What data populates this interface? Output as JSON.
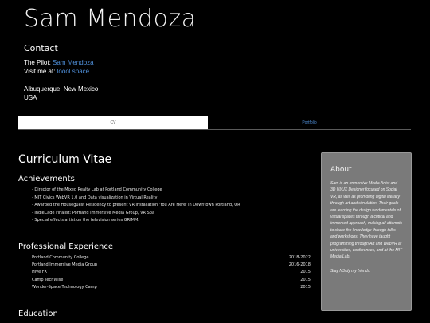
{
  "header": {
    "name": "Sam Mendoza"
  },
  "contact": {
    "heading": "Contact",
    "pilot_prefix": "The Pilot: ",
    "pilot_link": "Sam Mendoza",
    "visit_prefix": "Visit me at: ",
    "visit_link": "loool.space",
    "city": "Albuquerque, New Mexico",
    "country": "USA"
  },
  "tabs": [
    {
      "label": "CV",
      "active": true
    },
    {
      "label": "Portfolio",
      "active": false
    }
  ],
  "main": {
    "title": "Curriculum Vitae",
    "achievements": {
      "heading": "Achievements",
      "items": [
        "Director of the Mixed Realty Lab at Portland Community College",
        "MIT Civics WebVR 1.0 and Data visualization in Virtual Reality",
        "Awarded the Houseguest Residency to present VR installation 'You Are Here' in Downtown Portland, OR",
        "IndieCade Finalist: Portland Immersive Media Group, VR Spa",
        "Special effects artist on the television series GRIMM."
      ]
    },
    "experience": {
      "heading": "Professional Experience",
      "rows": [
        {
          "org": "Portland Community College",
          "years": "2018-2022"
        },
        {
          "org": "Portland Immersive Media Group",
          "years": "2016-2018"
        },
        {
          "org": "Hive FX",
          "years": "2015"
        },
        {
          "org": "Camp TechWise",
          "years": "2015"
        },
        {
          "org": "Wonder-Space Technology Camp",
          "years": "2015"
        }
      ]
    },
    "education": {
      "heading": "Education"
    }
  },
  "about": {
    "heading": "About",
    "body": "Sam is an Immersive Media Artist and 3D UI/UX Designer focused on Social VR, as well as promoting digital literacy through art and simulation. Their goals are learning the design fundamentals of virtual spaces through a critical and immersed approach, making all attempts to share the knowledge through talks and workshops. They have taught programming through Art and WebVR at universities, conferences, and at the MIT Media Lab.",
    "tagline": "Stay N3rdy my friends."
  }
}
